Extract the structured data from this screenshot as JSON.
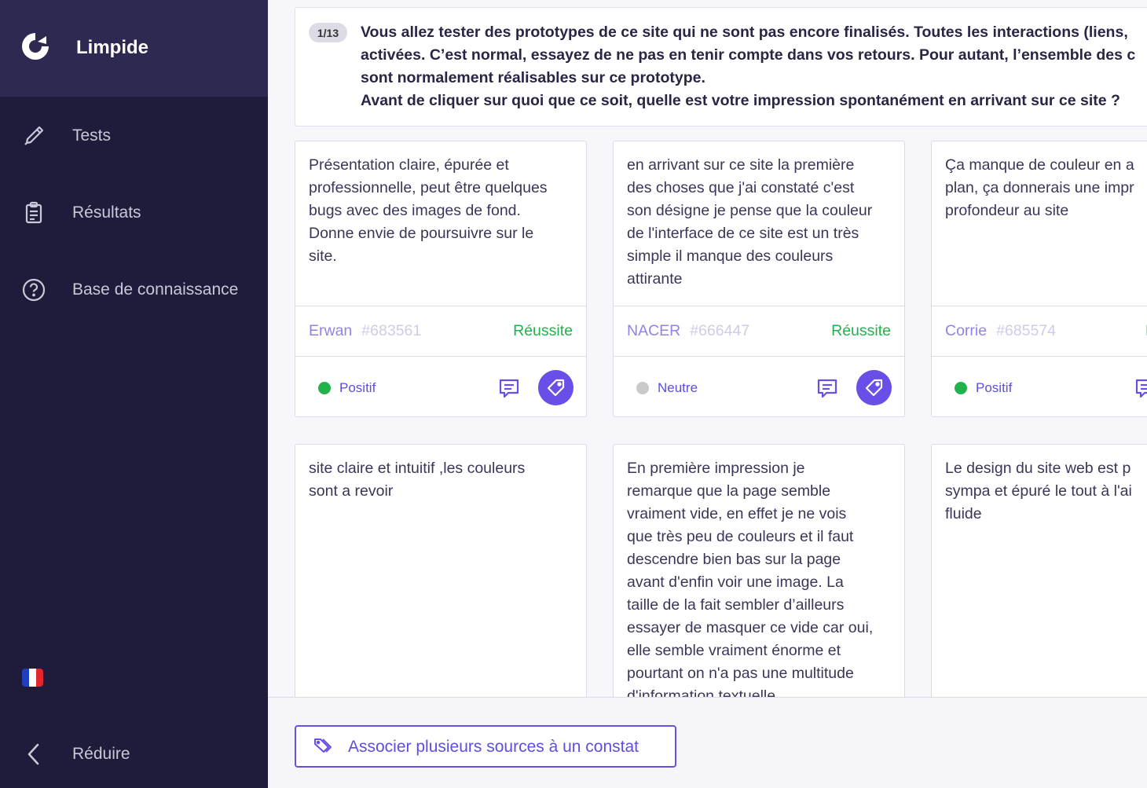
{
  "app": {
    "name": "Limpide"
  },
  "sidebar": {
    "items": [
      {
        "label": "Tests",
        "icon": "pen-icon"
      },
      {
        "label": "Résultats",
        "icon": "clipboard-icon"
      },
      {
        "label": "Base de connaissance",
        "icon": "help-circle-icon"
      }
    ],
    "language_flag": "french-flag-icon",
    "collapse_label": "Réduire"
  },
  "question": {
    "counter": "1/13",
    "lines": [
      "Vous allez tester des prototypes de ce site qui ne sont pas encore finalisés. Toutes les interactions (liens,",
      "activées. C’est normal, essayez de ne pas en tenir compte dans vos retours. Pour autant, l’ensemble des c",
      "sont normalement réalisables sur ce prototype.",
      "Avant de cliquer sur quoi que ce soit, quelle est votre impression spontanément en arrivant sur ce site ?"
    ]
  },
  "cards": [
    {
      "lines": [
        "Présentation claire, épurée et",
        "professionnelle, peut être quelques",
        "bugs avec des images de fond.",
        "Donne envie de poursuivre sur le",
        "site."
      ],
      "author": "Erwan",
      "id": "#683561",
      "status": "Réussite",
      "sentiment": "Positif",
      "sentiment_color": "#22b24c"
    },
    {
      "lines": [
        "en arrivant sur ce site la première",
        "des choses que j'ai constaté c'est",
        "son désigne je pense que la couleur",
        "de l'interface de ce site est un très",
        "simple il manque des couleurs",
        "attirante"
      ],
      "author": "NACER",
      "id": "#666447",
      "status": "Réussite",
      "sentiment": "Neutre",
      "sentiment_color": "#c9c9c9"
    },
    {
      "lines": [
        "Ça manque de couleur en a",
        "plan, ça donnerais une impr",
        "profondeur au site"
      ],
      "author": "Corrie",
      "id": "#685574",
      "status": "R",
      "sentiment": "Positif",
      "sentiment_color": "#22b24c"
    },
    {
      "lines": [
        "site claire et intuitif ,les couleurs",
        "sont a revoir"
      ]
    },
    {
      "lines": [
        "En première impression je",
        "remarque que la page semble",
        "vraiment vide, en effet je ne vois",
        "que très peu de couleurs et il faut",
        "descendre bien bas sur la page",
        "avant d'enfin voir une image. La",
        "taille de la fait sembler d’ailleurs",
        "essayer de masquer ce vide car oui,",
        "elle semble vraiment énorme et",
        "pourtant on n'a pas une multitude",
        "d'information textuelle"
      ]
    },
    {
      "lines": [
        "Le design du site web est p",
        "sympa et épuré le tout à l'ai",
        "fluide"
      ]
    }
  ],
  "colors": {
    "sidebar": "#1f1c3b",
    "brand": "#2d2950",
    "accent": "#6a4ee8",
    "success": "#22b24c"
  },
  "bottom": {
    "associate_label": "Associer plusieurs sources à un constat"
  }
}
